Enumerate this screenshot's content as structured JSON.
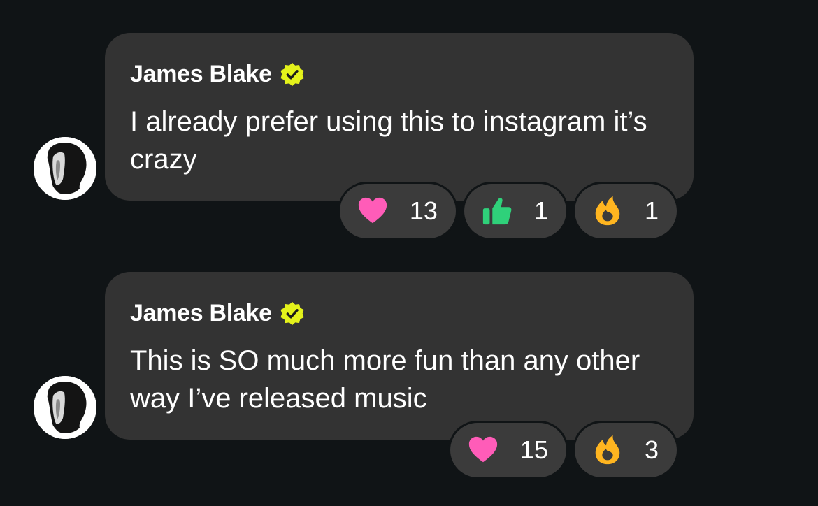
{
  "colors": {
    "background": "#101416",
    "bubble": "#333333",
    "chip": "#3b3b3b",
    "verified": "#e4f21b",
    "heart": "#ff5cb8",
    "thumbs_up": "#2fd17a",
    "fire": "#ffb520"
  },
  "comments": [
    {
      "avatar_icon": "avatar-image",
      "author": "James Blake",
      "verified_icon": "verified-badge-icon",
      "text": "I already prefer using this to instagram it’s crazy",
      "reactions": [
        {
          "icon": "heart-icon",
          "count": "13"
        },
        {
          "icon": "thumbs-up-icon",
          "count": "1"
        },
        {
          "icon": "fire-icon",
          "count": "1"
        }
      ]
    },
    {
      "avatar_icon": "avatar-image",
      "author": "James Blake",
      "verified_icon": "verified-badge-icon",
      "text": "This is SO much more fun than any other way I’ve released music",
      "reactions": [
        {
          "icon": "heart-icon",
          "count": "15"
        },
        {
          "icon": "fire-icon",
          "count": "3"
        }
      ]
    }
  ]
}
